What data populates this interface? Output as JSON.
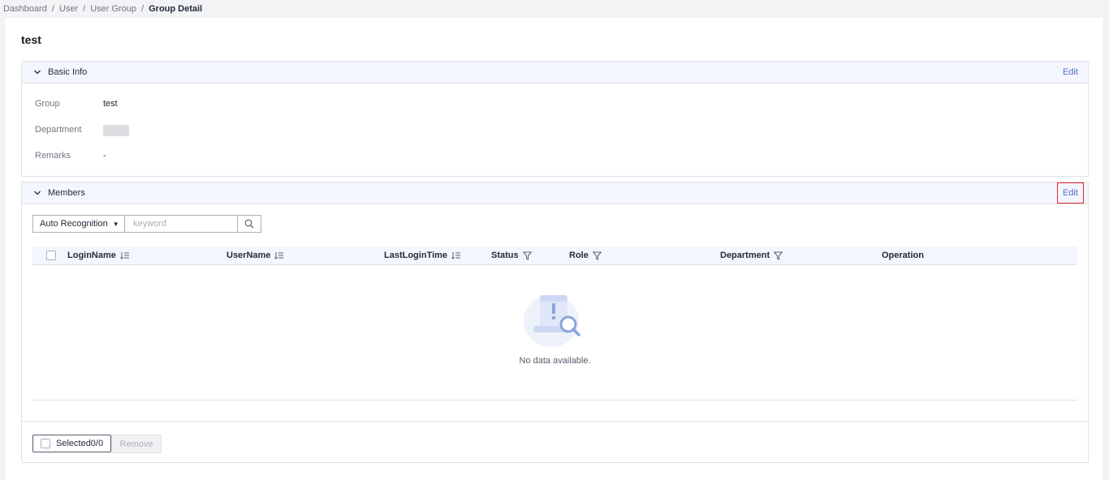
{
  "breadcrumb": {
    "items": [
      "Dashboard",
      "User",
      "User Group"
    ],
    "current": "Group Detail",
    "separator": "/"
  },
  "page_title": "test",
  "basic_info": {
    "title": "Basic Info",
    "edit_label": "Edit",
    "rows": [
      {
        "label": "Group",
        "value": "test"
      },
      {
        "label": "Department",
        "value": ""
      },
      {
        "label": "Remarks",
        "value": "-"
      }
    ]
  },
  "members": {
    "title": "Members",
    "edit_label": "Edit",
    "search": {
      "mode": "Auto Recognition",
      "placeholder": "keyword"
    },
    "columns": [
      "LoginName",
      "UserName",
      "LastLoginTime",
      "Status",
      "Role",
      "Department",
      "Operation"
    ],
    "empty_text": "No data available.",
    "selected_label": "Selected0/0",
    "remove_label": "Remove"
  },
  "colors": {
    "accent": "#526ecc",
    "highlight_border": "#e0262e",
    "header_bg": "#f3f6fd"
  },
  "icons": [
    "chevron-down-icon",
    "search-icon",
    "sort-icon",
    "filter-icon",
    "empty-data-icon"
  ]
}
